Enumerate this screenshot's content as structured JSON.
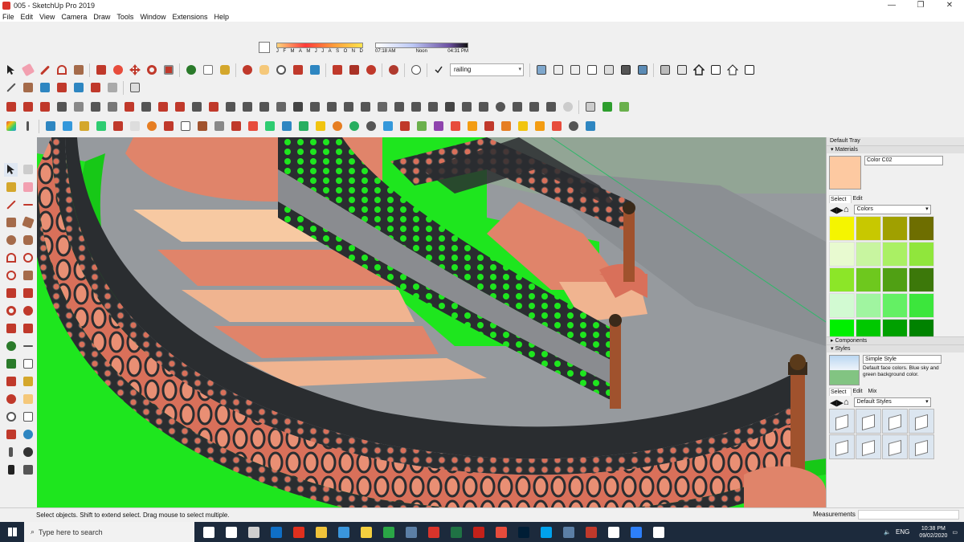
{
  "window": {
    "title": "005 - SketchUp Pro 2019",
    "controls": [
      "—",
      "❐",
      "✕"
    ]
  },
  "menu": [
    "File",
    "Edit",
    "View",
    "Camera",
    "Draw",
    "Tools",
    "Window",
    "Extensions",
    "Help"
  ],
  "shadows": {
    "months": [
      "J",
      "F",
      "M",
      "A",
      "M",
      "J",
      "J",
      "A",
      "S",
      "O",
      "N",
      "D"
    ],
    "time_start": "07:18 AM",
    "time_mid": "Noon",
    "time_end": "04:31 PM"
  },
  "layer": {
    "value": "railing"
  },
  "status": {
    "hint": "Select objects. Shift to extend select. Drag mouse to select multiple.",
    "measurements_label": "Measurements"
  },
  "tray": {
    "title": "Default Tray",
    "materials": {
      "title": "Materials",
      "current_name": "Color C02",
      "current_color": "#fdc9a1",
      "tabs": [
        "Select",
        "Edit"
      ],
      "library": "Colors",
      "swatches": [
        "#f5f500",
        "#c8c800",
        "#a0a000",
        "#6e6e00",
        "#e8fad0",
        "#c8f5a0",
        "#aaf064",
        "#90e63c",
        "#8ce628",
        "#6ec81e",
        "#50a014",
        "#3c780a",
        "#d2fad2",
        "#a0f5a0",
        "#64f064",
        "#3ce63c",
        "#00f000",
        "#00c800",
        "#00a000",
        "#008200",
        "#c8fafa",
        "#a0f5f5",
        "#6ef0f0",
        "#3ce6e6"
      ]
    },
    "components": {
      "title": "Components"
    },
    "styles": {
      "title": "Styles",
      "current_name": "Simple Style",
      "description": "Default face colors. Blue sky and green background color.",
      "tabs": [
        "Select",
        "Edit",
        "Mix"
      ],
      "library": "Default Styles"
    }
  },
  "taskbar": {
    "search_placeholder": "Type here to search",
    "clock_time": "10:38 PM",
    "clock_date": "09/02/2020",
    "language": "ENG",
    "apps": [
      "#ffffff",
      "#ffffff",
      "#cfcfcf",
      "#0f6fc6",
      "#e0301e",
      "#f0c33a",
      "#3a96dd",
      "#f4d03f",
      "#2aa646",
      "#5b7fa6",
      "#d9342b",
      "#1f7244",
      "#c4211a",
      "#e74c3c",
      "#001e36",
      "#00a2ed",
      "#5b7fa6",
      "#c0392b",
      "#ffffff",
      "#2d7ff9",
      "#ffffff"
    ]
  },
  "colors": {
    "ground": "#969a9e",
    "step": "#e0846a",
    "iron": "#2a2d30",
    "green": "#1ee61e",
    "sky_grid": "#2fb86a"
  }
}
